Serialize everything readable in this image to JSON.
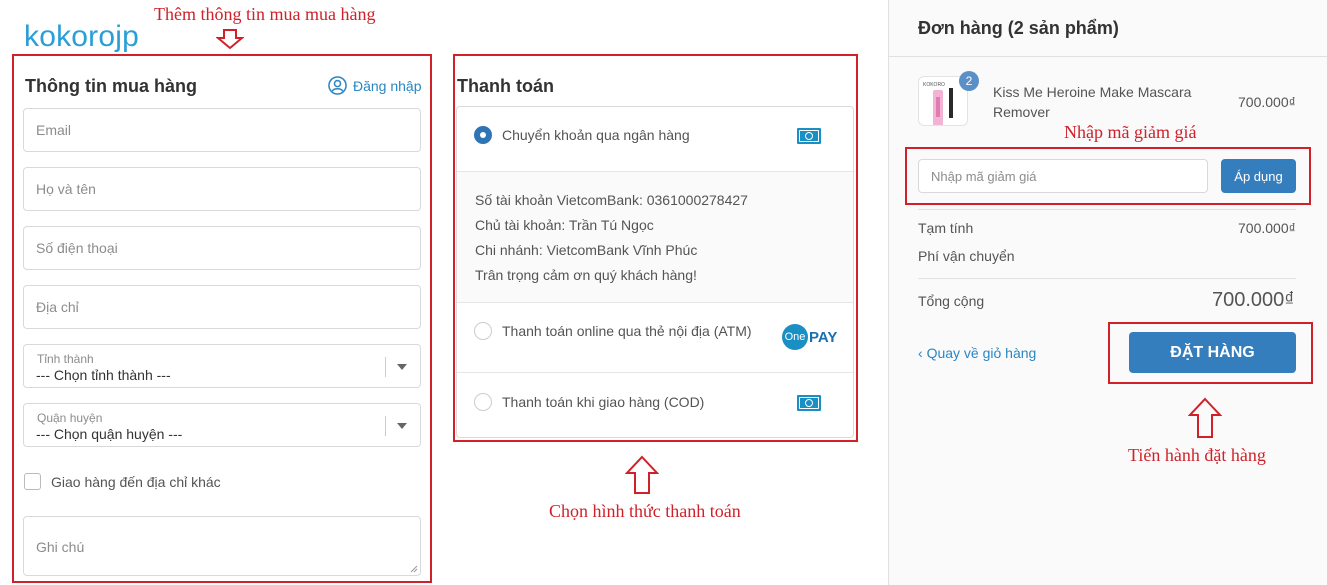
{
  "store": {
    "logo": "kokorojp"
  },
  "annotations": {
    "add_info": "Thêm thông tin mua mua hàng",
    "choose_payment": "Chọn hình thức thanh toán",
    "coupon": "Nhập mã giảm giá",
    "place_order": "Tiến hành đặt hàng",
    "color": "#d0212a"
  },
  "buyer": {
    "title": "Thông tin mua hàng",
    "login_label": "Đăng nhập",
    "email_placeholder": "Email",
    "name_placeholder": "Họ và tên",
    "phone_placeholder": "Số điện thoại",
    "address_placeholder": "Địa chỉ",
    "province_label": "Tỉnh thành",
    "province_value": "--- Chọn tỉnh thành ---",
    "district_label": "Quận huyện",
    "district_value": "--- Chọn quận huyện ---",
    "other_address_label": "Giao hàng đến địa chỉ khác",
    "note_placeholder": "Ghi chú"
  },
  "payment": {
    "title": "Thanh toán",
    "options": [
      {
        "label": "Chuyển khoản qua ngân hàng",
        "selected": true,
        "icon": "cash-icon"
      },
      {
        "label": "Thanh toán online qua thẻ nội địa (ATM)",
        "selected": false,
        "icon": "onepay-logo"
      },
      {
        "label": "Thanh toán khi giao hàng (COD)",
        "selected": false,
        "icon": "cash-icon"
      }
    ],
    "bank_info": [
      "Số tài khoản VietcomBank: 0361000278427",
      "Chủ tài khoản: Trần Tú Ngọc",
      "Chi nhánh: VietcomBank Vĩnh Phúc",
      "Trân trọng cảm ơn quý khách hàng!"
    ],
    "onepay_one": "One",
    "onepay_pay": "PAY"
  },
  "order": {
    "title": "Đơn hàng (2 sản phẩm)",
    "item": {
      "quantity": "2",
      "name": "Kiss Me Heroine Make Mascara Remover",
      "price": "700.000₫",
      "thumb_text": "KOKORO"
    },
    "coupon_placeholder": "Nhập mã giảm giá",
    "apply_label": "Áp dụng",
    "subtotal_label": "Tạm tính",
    "subtotal_value": "700.000₫",
    "shipping_label": "Phí vận chuyển",
    "total_label": "Tổng cộng",
    "total_value": "700.000₫",
    "back_label": "Quay về giỏ hàng",
    "place_order_label": "ĐẶT HÀNG",
    "accent_color": "#357ebd"
  }
}
